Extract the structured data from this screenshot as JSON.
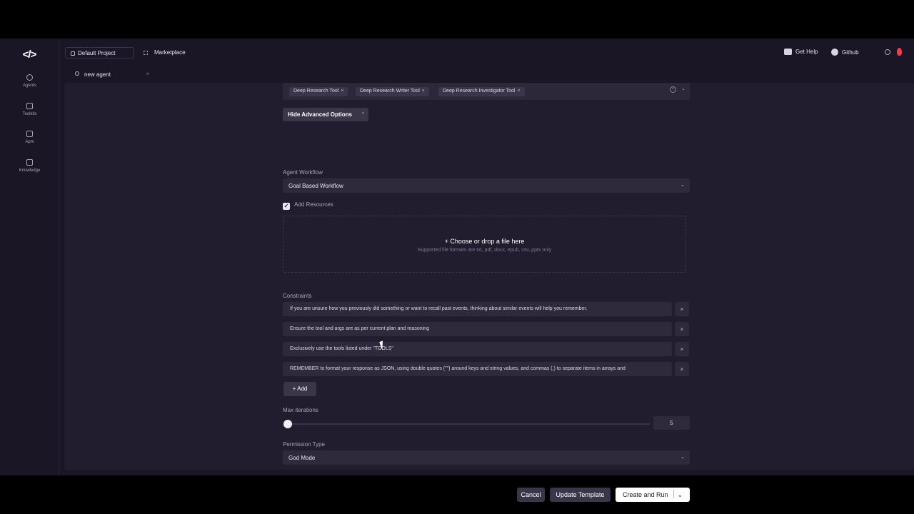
{
  "sidebar": {
    "logo": "</>",
    "items": [
      {
        "label": "Agents",
        "icon": "agents-icon"
      },
      {
        "label": "Toolkits",
        "icon": "toolkits-icon"
      },
      {
        "label": "Apm",
        "icon": "apm-icon"
      },
      {
        "label": "Knowledge",
        "icon": "knowledge-icon"
      }
    ]
  },
  "topbar": {
    "project": "Default Project",
    "marketplace": "Marketplace",
    "get_help": "Get Help",
    "github": "Github"
  },
  "tab": {
    "label": "new agent",
    "close": "×"
  },
  "form": {
    "tools": [
      {
        "label": "Deep Research Tool"
      },
      {
        "label": "Deep Research Writer Tool"
      },
      {
        "label": "Deep Research Investigator Tool"
      }
    ],
    "chip_remove": "×",
    "hide_advanced": "Hide Advanced Options",
    "agent_workflow_label": "Agent Workflow",
    "agent_workflow_value": "Goal Based Workflow",
    "add_resources_label": "Add Resources",
    "add_resources_checked": true,
    "dropzone_title": "+ Choose or drop a file here",
    "dropzone_subtitle": "Supported file formats are txt, pdf, docx, epub, csv, pptx only",
    "constraints_label": "Constraints",
    "constraints": [
      "If you are unsure how you previously did something or want to recall past events, thinking about similar events will help you remember.",
      "Ensure the tool and args are as per current plan and reasoning",
      "Exclusively use the tools listed under \"TOOLS\"",
      "REMEMBER to format your response as JSON, using double quotes (\"\") around keys and string values, and commas (,) to separate items in arrays and"
    ],
    "add_label": "+ Add",
    "max_iterations_label": "Max iterations",
    "max_iterations_value": "5",
    "max_iterations_fraction": 0.0,
    "permission_label": "Permission Type",
    "permission_value": "God Mode"
  },
  "actions": {
    "cancel": "Cancel",
    "update_template": "Update Template",
    "create_and_run": "Create and Run"
  },
  "colors": {
    "background": "#1b1625",
    "panel": "#221d2e",
    "input": "#2f2a3b",
    "button": "#3b3549",
    "brand_red": "#e8404c"
  }
}
